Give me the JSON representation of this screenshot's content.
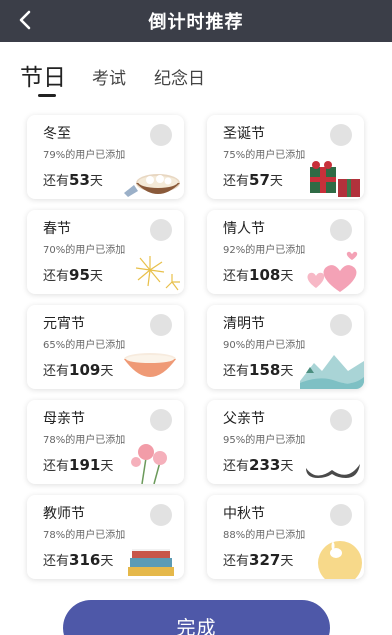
{
  "header": {
    "title": "倒计时推荐"
  },
  "tabs": [
    {
      "label": "节日"
    },
    {
      "label": "考试"
    },
    {
      "label": "纪念日"
    }
  ],
  "cards": [
    {
      "name": "冬至",
      "added": "79%的用户已添加",
      "prefix": "还有",
      "days": "53",
      "suffix": "天",
      "art": "dumpling-bowl"
    },
    {
      "name": "圣诞节",
      "added": "75%的用户已添加",
      "prefix": "还有",
      "days": "57",
      "suffix": "天",
      "art": "gift-box"
    },
    {
      "name": "春节",
      "added": "70%的用户已添加",
      "prefix": "还有",
      "days": "95",
      "suffix": "天",
      "art": "fireworks"
    },
    {
      "name": "情人节",
      "added": "92%的用户已添加",
      "prefix": "还有",
      "days": "108",
      "suffix": "天",
      "art": "hearts"
    },
    {
      "name": "元宵节",
      "added": "65%的用户已添加",
      "prefix": "还有",
      "days": "109",
      "suffix": "天",
      "art": "bowl"
    },
    {
      "name": "清明节",
      "added": "90%的用户已添加",
      "prefix": "还有",
      "days": "158",
      "suffix": "天",
      "art": "landscape"
    },
    {
      "name": "母亲节",
      "added": "78%的用户已添加",
      "prefix": "还有",
      "days": "191",
      "suffix": "天",
      "art": "carnation"
    },
    {
      "name": "父亲节",
      "added": "95%的用户已添加",
      "prefix": "还有",
      "days": "233",
      "suffix": "天",
      "art": "mustache"
    },
    {
      "name": "教师节",
      "added": "78%的用户已添加",
      "prefix": "还有",
      "days": "316",
      "suffix": "天",
      "art": "books"
    },
    {
      "name": "中秋节",
      "added": "88%的用户已添加",
      "prefix": "还有",
      "days": "327",
      "suffix": "天",
      "art": "moon-rabbit"
    }
  ],
  "footer": {
    "done_label": "完成"
  }
}
